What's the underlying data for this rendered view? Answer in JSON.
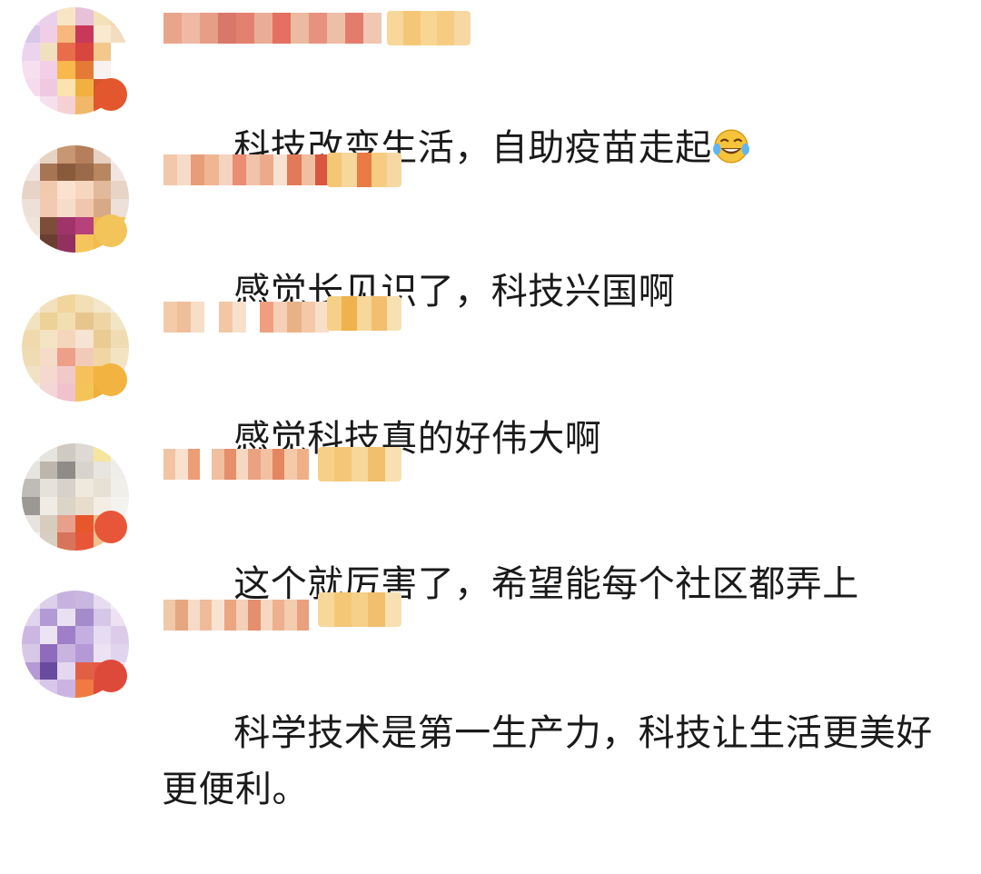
{
  "comments": [
    {
      "text": "科技改变生活，自助疫苗走起",
      "emoji": "laughing-tears",
      "avatar_colors": [
        "#f4d8f0",
        "#ead0ea",
        "#f7e5c5",
        "#e8c0d8",
        "#f3e2b7",
        "#f7d6a6",
        "#d8c8e8",
        "#f0cfe6",
        "#f7b77d",
        "#c9385a",
        "#f8e9cf",
        "#f3ddc1",
        "#ecd4ee",
        "#f1e0bf",
        "#e96c4b",
        "#d8463e",
        "#f3c88b",
        "#ffffff",
        "#f6e0ef",
        "#f3cfe7",
        "#f8b84c",
        "#e57a36",
        "#f7f1f0",
        "#ffffff",
        "#f6dbef",
        "#efc9e2",
        "#fbe3b0",
        "#f2b040",
        "#d6582a",
        "#ffffff",
        "#ffffff",
        "#f5e1ee",
        "#f6d1d3",
        "#f0b868",
        "#e2572d",
        "#ffffff"
      ],
      "badge_color": "#e2572d",
      "name_colors": [
        "#e8a58c",
        "#efb9a4",
        "#e69e86",
        "#d9776a",
        "#e38170",
        "#e9ad97",
        "#e46f62",
        "#ebbaa0",
        "#e6927e",
        "#eebfa7",
        "#e47c6d",
        "#f1c7b1"
      ],
      "level_colors": [
        "#f7d79a",
        "#f4c777",
        "#f8d590",
        "#f5cc82",
        "#f7d8a2"
      ]
    },
    {
      "text": "感觉长见识了，科技兴国啊",
      "avatar_colors": [
        "#f5f0ee",
        "#e8d3c3",
        "#c79672",
        "#b57f5c",
        "#e7d1c1",
        "#f5f0ee",
        "#f1e6df",
        "#a77454",
        "#8a5a3d",
        "#9b6a4b",
        "#b8865f",
        "#f1e6df",
        "#e8d4c6",
        "#f2c9ad",
        "#fbe2cf",
        "#f6d6bf",
        "#e2b99b",
        "#e8d4c6",
        "#ece0d8",
        "#f3c9b1",
        "#f6dccb",
        "#f0c7ae",
        "#d8a986",
        "#ece0d8",
        "#efe3dc",
        "#7c4e3a",
        "#a1336b",
        "#b6417b",
        "#f2b94a",
        "#f3c45a",
        "#f5efec",
        "#6a3e30",
        "#923160",
        "#f6c45c",
        "#f2bb4d",
        "#f5efec"
      ],
      "badge_color": "#f3c45a",
      "name_colors": [
        "#f3c7ab",
        "#f7dbc9",
        "#e69e78",
        "#efb693",
        "#f4d4c0",
        "#e98d73",
        "#f1c3a8",
        "#ecaa8c",
        "#f7e1d1",
        "#e27958",
        "#f0bea0",
        "#d8563f"
      ],
      "level_colors": [
        "#f4c777",
        "#f7d79a",
        "#e97b45",
        "#f5cc82",
        "#f7d8a2"
      ]
    },
    {
      "text": "感觉科技真的好伟大啊",
      "avatar_colors": [
        "#f6f0e4",
        "#f3e1bd",
        "#f0d59d",
        "#f3dfb6",
        "#f4e6c9",
        "#f6f0e4",
        "#f2e2c0",
        "#edd196",
        "#f3deb2",
        "#e7c68d",
        "#f0d5a4",
        "#f2e4c6",
        "#efd9ad",
        "#f5e4c4",
        "#f5d6bc",
        "#f7e3d1",
        "#e9cb93",
        "#efdcb4",
        "#f0dcb3",
        "#f6dcc8",
        "#ee9f8a",
        "#f2cbb8",
        "#f1d6a4",
        "#f3e3c2",
        "#f1e2c5",
        "#f5d8cf",
        "#f2c9c9",
        "#f6c05a",
        "#f3b340",
        "#f4e7cf",
        "#f5ece0",
        "#f2d6d8",
        "#f0c2cd",
        "#f5c458",
        "#f1ae3c",
        "#f6eee3"
      ],
      "badge_color": "#f3b340",
      "name_colors": [
        "#f3cba9",
        "#efbf9c",
        "#f7dec6",
        "#ffffff",
        "#f2c7a5",
        "#f7e1cc",
        "#ffffff",
        "#ef9f7e",
        "#f5d0b7",
        "#e8b286",
        "#f3c9a8",
        "#f7dfc9"
      ],
      "level_colors": [
        "#f6d088",
        "#efb24c",
        "#f7d79a",
        "#f2bf6e",
        "#f7e0b1"
      ]
    },
    {
      "text": "这个就厉害了，希望能每个社区都弄上",
      "avatar_colors": [
        "#f2f2ef",
        "#e6e4df",
        "#cfcac2",
        "#dedad3",
        "#f6e59e",
        "#f1f0ec",
        "#e6e4df",
        "#bcb6ad",
        "#8f8b87",
        "#d8d4cd",
        "#e8e5df",
        "#efede9",
        "#bfbbb6",
        "#e5e2dc",
        "#d6d1ca",
        "#efe8dc",
        "#e6e0d5",
        "#f1efe9",
        "#9c9894",
        "#f0ece5",
        "#dcd4c7",
        "#e8ddcc",
        "#f3ede3",
        "#f5f3ef",
        "#e7e4df",
        "#d6cdbd",
        "#e8a08b",
        "#e8562c",
        "#f0bc86",
        "#f6f4f1",
        "#f4f2ee",
        "#d7cfc2",
        "#d77459",
        "#e8563a",
        "#f2c08c",
        "#f7f5f2"
      ],
      "badge_color": "#e8563a",
      "name_colors": [
        "#f2c4a4",
        "#f8e2cf",
        "#ed9d76",
        "#ffffff",
        "#f2bfa0",
        "#e78e6a",
        "#f6d8c1",
        "#e9a381",
        "#f3c1a2",
        "#e58661",
        "#f4caa9",
        "#f0b086"
      ],
      "level_colors": [
        "#f6d088",
        "#f4c777",
        "#f7d79a",
        "#f2bf6e",
        "#f7e0b1"
      ]
    },
    {
      "text": "科学技术是第一生产力，科技让生活更美好更便利。",
      "avatar_colors": [
        "#f4eef6",
        "#ddd0ea",
        "#c7b2df",
        "#cab7df",
        "#e8dcf0",
        "#f4eef6",
        "#e1d4ee",
        "#b29ad5",
        "#e9e1f2",
        "#a48bc9",
        "#d6c7e8",
        "#ece2f2",
        "#cbb7e1",
        "#ece4f4",
        "#9e7fc8",
        "#c5afe0",
        "#e6dcf1",
        "#dcccea",
        "#d8c8e8",
        "#8f6bbb",
        "#c9b4e0",
        "#b499d6",
        "#ece2f3",
        "#e1d4ee",
        "#b59ad7",
        "#6a4a9f",
        "#e4d8f0",
        "#e06044",
        "#e9584a",
        "#efe7f5",
        "#ece4f4",
        "#d8c7ea",
        "#cbb4e2",
        "#f07a42",
        "#de4a3a",
        "#f3edf7"
      ],
      "badge_color": "#de4a3a",
      "name_colors": [
        "#f1c8a8",
        "#e6a67f",
        "#f6dcc6",
        "#f0bb9a",
        "#f8e3d2",
        "#eba67f",
        "#f3d0b7",
        "#e48f6d",
        "#f6d8c2",
        "#eeb08e",
        "#f4ccae",
        "#e9a07c"
      ],
      "level_colors": [
        "#f7d79a",
        "#f4c777",
        "#f6d088",
        "#f2bf6e",
        "#f7e0b1"
      ]
    }
  ]
}
